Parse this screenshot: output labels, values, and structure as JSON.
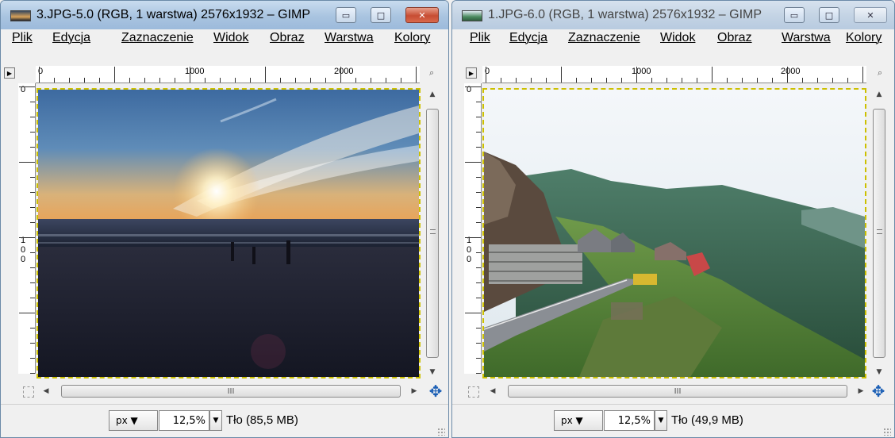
{
  "windows": [
    {
      "title": "3.JPG-5.0 (RGB, 1 warstwa) 2576x1932 – GIMP",
      "menu": [
        "Plik",
        "Edycja",
        "Zaznaczenie",
        "Widok",
        "Obraz",
        "Warstwa",
        "Kolory"
      ],
      "ruler_h": [
        "0",
        "1000",
        "2000"
      ],
      "ruler_v": [
        "0",
        "1",
        "0",
        "0"
      ],
      "unit": "px",
      "zoom": "12,5%",
      "status": "Tło (85,5 MB)",
      "image": "sunset-beach-photo",
      "scroll_thumb_label": "III"
    },
    {
      "title": "1.JPG-6.0 (RGB, 1 warstwa) 2576x1932 – GIMP",
      "menu": [
        "Plik",
        "Edycja",
        "Zaznaczenie",
        "Widok",
        "Obraz",
        "Warstwa",
        "Kolory"
      ],
      "ruler_h": [
        "0",
        "1000",
        "2000"
      ],
      "ruler_v": [
        "0",
        "1",
        "0",
        "0"
      ],
      "unit": "px",
      "zoom": "12,5%",
      "status": "Tło (49,9 MB)",
      "image": "mountain-road-photo",
      "scroll_thumb_label": "III"
    }
  ],
  "icons": {
    "unit_dropdown": "triangle-down",
    "navigate": "four-arrows-move",
    "zoom": "magnifier",
    "quickmask": "dashed-square"
  },
  "colors": {
    "selection_border": "#ccc000",
    "title_active": "#a9c4e0",
    "title_inactive": "#c3d3e4",
    "close_active": "#c74d33",
    "navigate_icon": "#1b5fb5"
  }
}
